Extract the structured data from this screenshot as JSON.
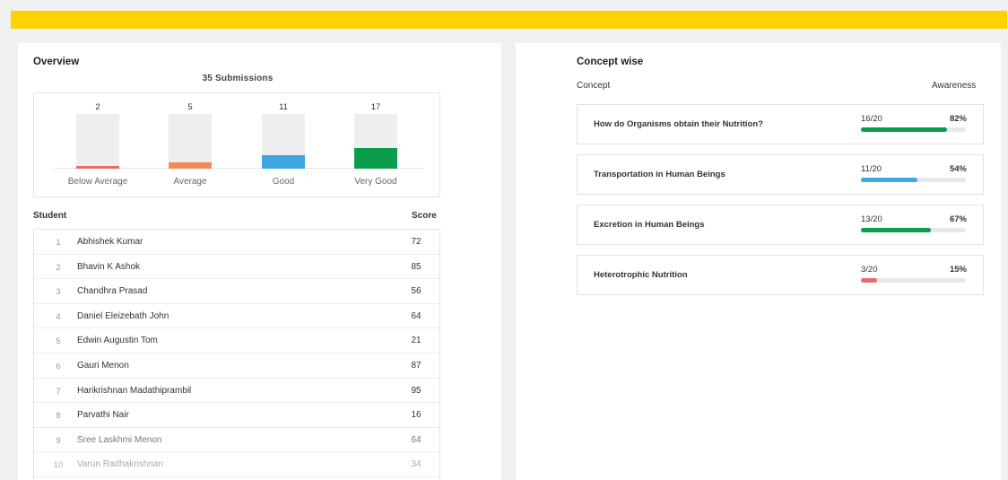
{
  "colors": {
    "accent_bar": "#fdd200",
    "below_average": "#e96a6a",
    "average": "#f28a55",
    "good": "#3fa6e0",
    "very_good": "#0a9e4c",
    "track": "#eeeeee"
  },
  "overview": {
    "title": "Overview",
    "submissions": "35 Submissions",
    "total": 35,
    "bars": [
      {
        "count": "2",
        "value": 2,
        "label": "Below Average",
        "color": "#e96a6a"
      },
      {
        "count": "5",
        "value": 5,
        "label": "Average",
        "color": "#f28a55"
      },
      {
        "count": "11",
        "value": 11,
        "label": "Good",
        "color": "#3fa6e0"
      },
      {
        "count": "17",
        "value": 17,
        "label": "Very Good",
        "color": "#0a9e4c"
      }
    ]
  },
  "students": {
    "student_header": "Student",
    "score_header": "Score",
    "rows": [
      {
        "index": "1",
        "name": "Abhishek Kumar",
        "score": "72"
      },
      {
        "index": "2",
        "name": "Bhavin K Ashok",
        "score": "85"
      },
      {
        "index": "3",
        "name": "Chandhra Prasad",
        "score": "56"
      },
      {
        "index": "4",
        "name": "Daniel Eleizebath John",
        "score": "64"
      },
      {
        "index": "5",
        "name": "Edwin Augustin Tom",
        "score": "21"
      },
      {
        "index": "6",
        "name": "Gauri Menon",
        "score": "87"
      },
      {
        "index": "7",
        "name": "Harikrishnan Madathiprambil",
        "score": "95"
      },
      {
        "index": "8",
        "name": "Parvathi Nair",
        "score": "16"
      },
      {
        "index": "9",
        "name": "Sree Laskhmi Menon",
        "score": "64"
      },
      {
        "index": "10",
        "name": "Varun Radhakrishnan",
        "score": "34"
      }
    ]
  },
  "concepts": {
    "title": "Concept wise",
    "concept_header": "Concept",
    "awareness_header": "Awareness",
    "items": [
      {
        "name": "How do Organisms obtain their Nutrition?",
        "ratio": "16/20",
        "percent": "82%",
        "fraction": 0.82,
        "color": "#0a9e4c"
      },
      {
        "name": "Transportation in Human Beings",
        "ratio": "11/20",
        "percent": "54%",
        "fraction": 0.54,
        "color": "#3fa6e0"
      },
      {
        "name": "Excretion in Human Beings",
        "ratio": "13/20",
        "percent": "67%",
        "fraction": 0.67,
        "color": "#0a9e4c"
      },
      {
        "name": "Heterotrophic Nutrition",
        "ratio": "3/20",
        "percent": "15%",
        "fraction": 0.15,
        "color": "#e96a6a"
      }
    ]
  }
}
